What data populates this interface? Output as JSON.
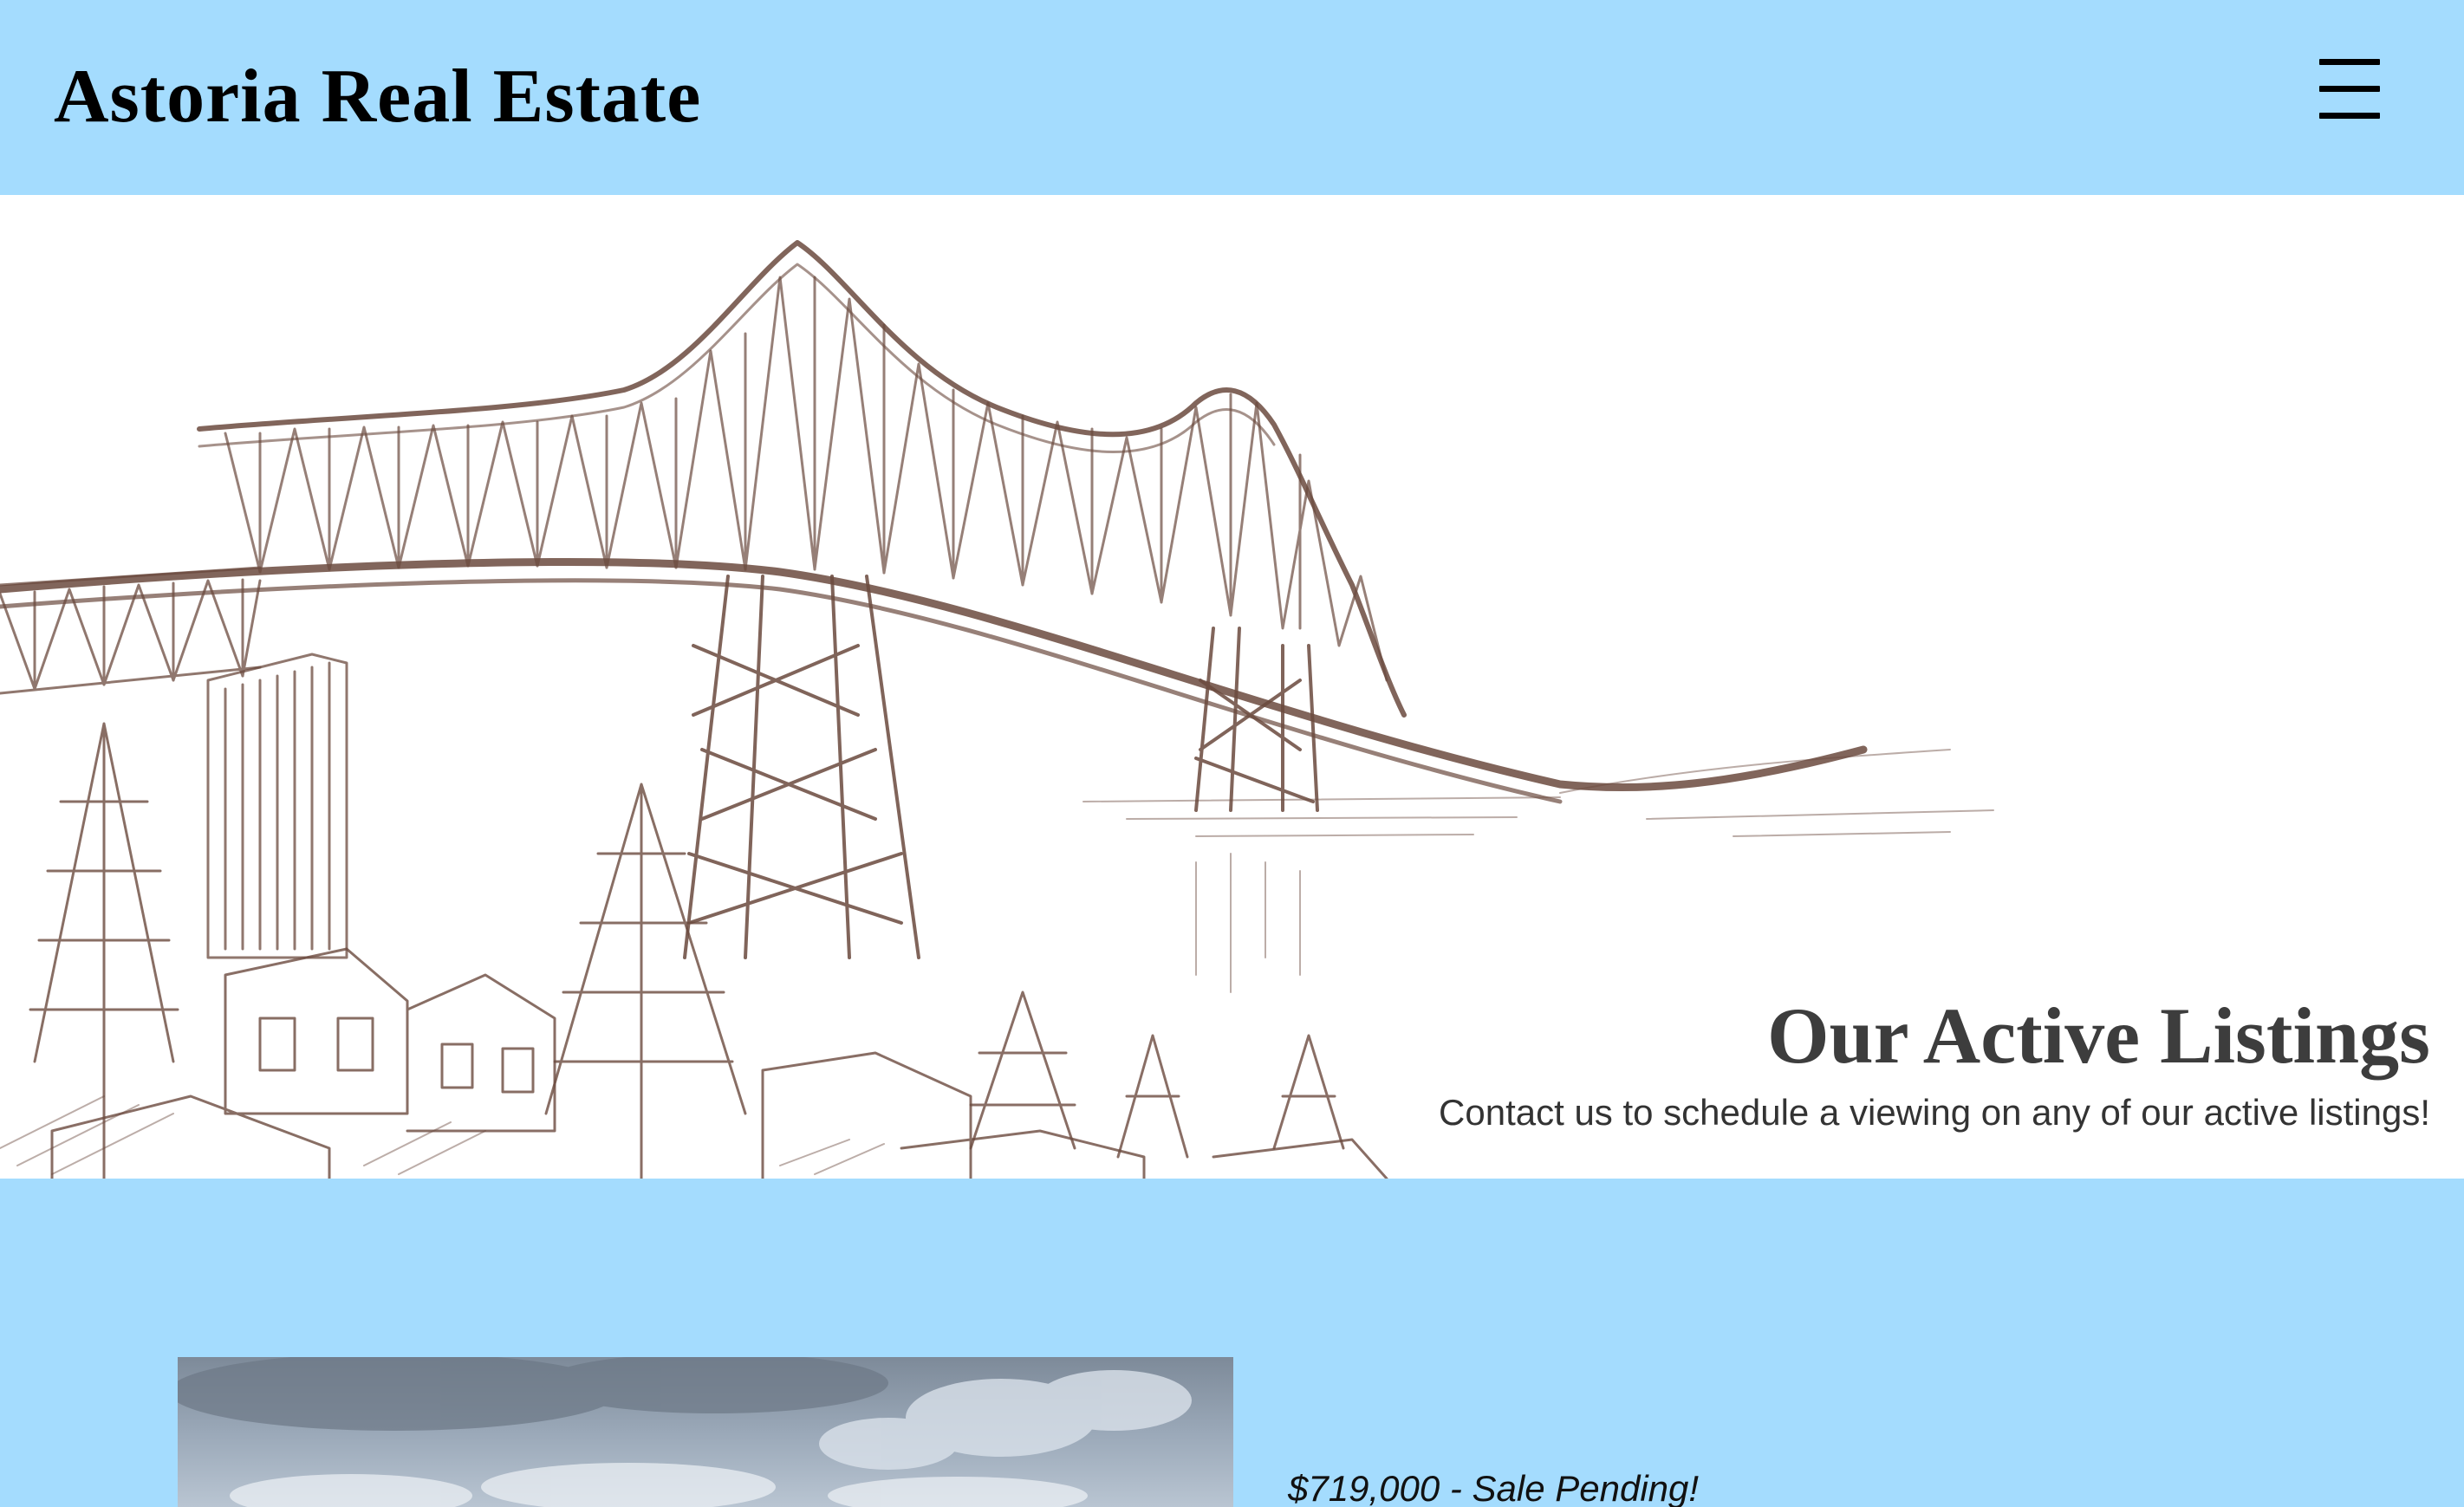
{
  "header": {
    "brand": "Astoria Real Estate",
    "menu_icon": "hamburger-menu-icon"
  },
  "hero": {
    "title": "Our Active Listings",
    "subtitle": "Contact us to schedule a viewing on any of our active listings!",
    "image_subject": "pencil sketch of the Astoria-Megler bridge over the river with pine trees and houses"
  },
  "listing": {
    "price_status": "$719,000 - Sale Pending!",
    "photo_subject": "cloudy sky over property"
  },
  "colors": {
    "page_background": "#a4dcfe",
    "sketch_ink": "#6b4a3e",
    "heading_text": "#3d3d3d"
  }
}
